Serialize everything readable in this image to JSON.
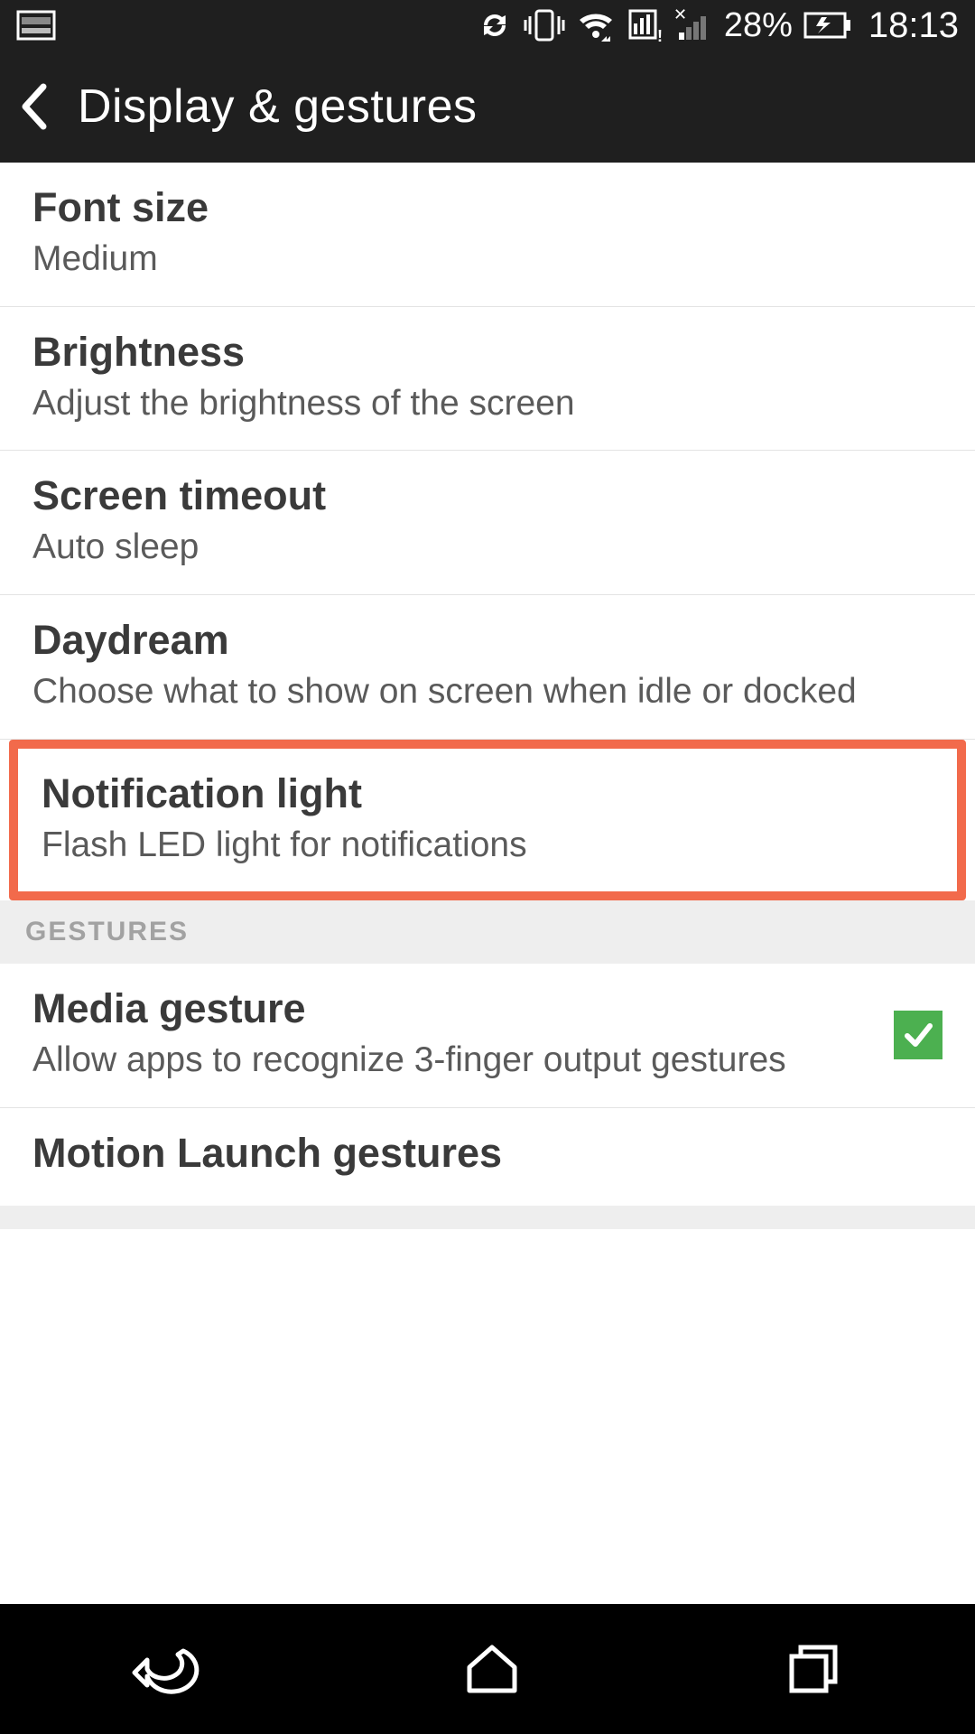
{
  "status_bar": {
    "battery_percent": "28%",
    "clock": "18:13"
  },
  "app_bar": {
    "title": "Display & gestures"
  },
  "items": [
    {
      "title": "Font size",
      "subtitle": "Medium"
    },
    {
      "title": "Brightness",
      "subtitle": "Adjust the brightness of the screen"
    },
    {
      "title": "Screen timeout",
      "subtitle": "Auto sleep"
    },
    {
      "title": "Daydream",
      "subtitle": "Choose what to show on screen when idle or docked"
    },
    {
      "title": "Notification light",
      "subtitle": "Flash LED light for notifications"
    }
  ],
  "section_header": "GESTURES",
  "gesture_items": [
    {
      "title": "Media gesture",
      "subtitle": "Allow apps to recognize 3-finger output gestures",
      "checked": true
    },
    {
      "title": "Motion Launch gestures",
      "subtitle": ""
    }
  ]
}
